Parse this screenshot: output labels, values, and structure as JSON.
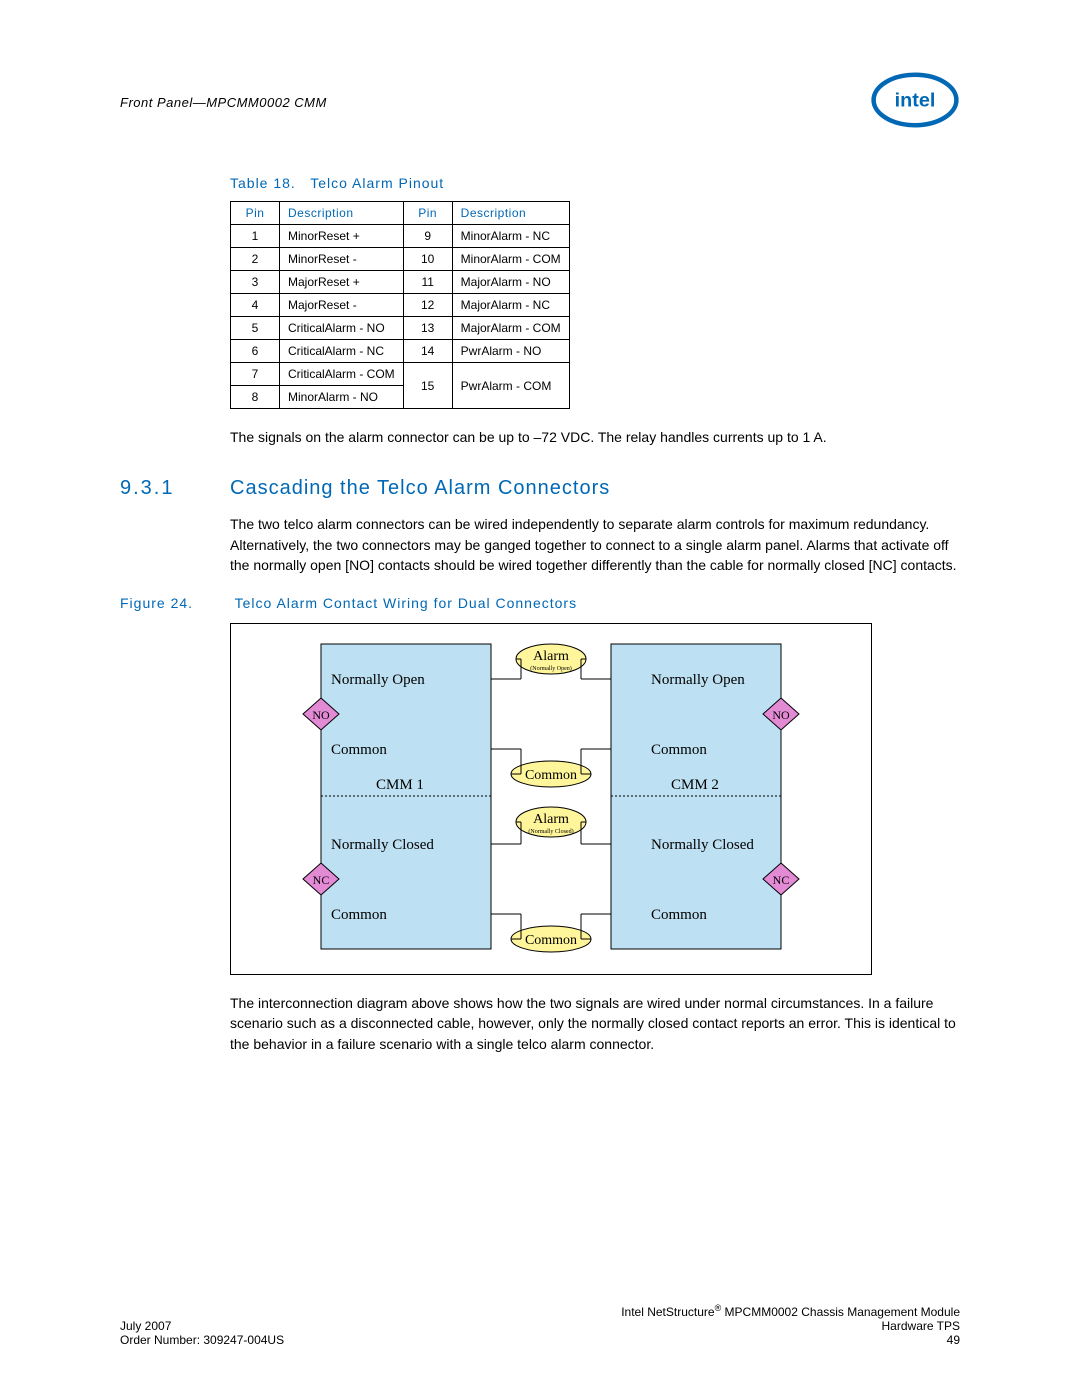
{
  "header": {
    "left": "Front Panel—MPCMM0002 CMM",
    "logo_alt": "intel"
  },
  "table18": {
    "caption_label": "Table 18.",
    "caption_title": "Telco Alarm Pinout",
    "headers": {
      "pin": "Pin",
      "desc": "Description"
    },
    "rows_left": [
      {
        "pin": "1",
        "desc": "MinorReset +"
      },
      {
        "pin": "2",
        "desc": "MinorReset -"
      },
      {
        "pin": "3",
        "desc": "MajorReset +"
      },
      {
        "pin": "4",
        "desc": "MajorReset -"
      },
      {
        "pin": "5",
        "desc": "CriticalAlarm - NO"
      },
      {
        "pin": "6",
        "desc": "CriticalAlarm - NC"
      },
      {
        "pin": "7",
        "desc": "CriticalAlarm - COM"
      },
      {
        "pin": "8",
        "desc": "MinorAlarm - NO"
      }
    ],
    "rows_right": [
      {
        "pin": "9",
        "desc": "MinorAlarm - NC"
      },
      {
        "pin": "10",
        "desc": "MinorAlarm - COM"
      },
      {
        "pin": "11",
        "desc": "MajorAlarm - NO"
      },
      {
        "pin": "12",
        "desc": "MajorAlarm - NC"
      },
      {
        "pin": "13",
        "desc": "MajorAlarm - COM"
      },
      {
        "pin": "14",
        "desc": "PwrAlarm - NO"
      },
      {
        "pin": "15",
        "desc": "PwrAlarm - COM"
      }
    ]
  },
  "para1": "The signals on the alarm connector can be up to –72 VDC. The relay handles currents up to 1 A.",
  "section": {
    "num": "9.3.1",
    "title": "Cascading the Telco Alarm Connectors"
  },
  "para2": "The two telco alarm connectors can be wired independently to separate alarm controls for maximum redundancy. Alternatively, the two connectors may be ganged together to connect to a single alarm panel. Alarms that activate off the normally open [NO] contacts should be wired together differently than the cable for normally closed [NC] contacts.",
  "figure24": {
    "label": "Figure 24.",
    "title": "Telco Alarm Contact Wiring for Dual Connectors"
  },
  "diagram": {
    "cmm1": "CMM 1",
    "cmm2": "CMM 2",
    "normally_open": "Normally Open",
    "normally_closed": "Normally Closed",
    "common": "Common",
    "alarm": "Alarm",
    "alarm_sub_open": "(Normally Open)",
    "alarm_sub_closed": "(Normally Closed)",
    "no": "NO",
    "nc": "NC"
  },
  "para3": "The interconnection diagram above shows how the two signals are wired under normal circumstances. In a failure scenario such as a disconnected cable, however, only the normally closed contact reports an error. This is identical to the behavior in a failure scenario with a single telco alarm connector.",
  "footer": {
    "right1_a": "Intel NetStructure",
    "right1_b": " MPCMM0002 Chassis Management Module",
    "right2": "Hardware TPS",
    "right3": "49",
    "left1": "July 2007",
    "left2": "Order Number: 309247-004US"
  },
  "colors": {
    "intel_blue": "#0068b5",
    "box_blue": "#bde0f2",
    "oval_yellow": "#fff59a",
    "diamond_magenta": "#e28ad4"
  }
}
